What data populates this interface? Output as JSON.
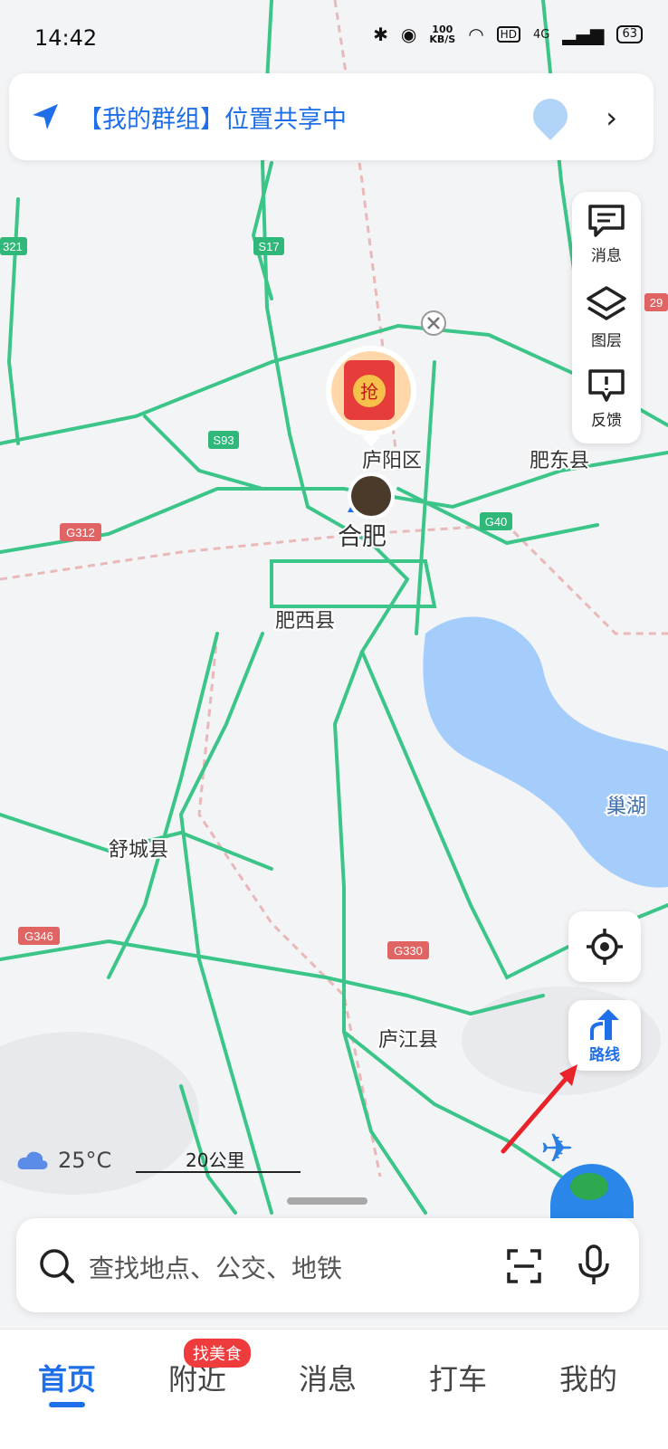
{
  "status_bar": {
    "time": "14:42",
    "speed_value": "100",
    "speed_unit": "KB/S",
    "network": "4G",
    "battery": "63"
  },
  "share_banner": {
    "text": "【我的群组】位置共享中"
  },
  "side_panel": {
    "messages": "消息",
    "layers": "图层",
    "feedback": "反馈"
  },
  "map_labels": {
    "districts": [
      "庐阳区",
      "肥东县",
      "合肥",
      "肥西县",
      "舒城县",
      "庐江县",
      "巢湖"
    ],
    "roads": [
      "S17",
      "S93",
      "G312",
      "G40",
      "G346",
      "G330",
      "321",
      "29"
    ]
  },
  "promo": {
    "text": "抢"
  },
  "weather": {
    "temp": "25°C"
  },
  "scale_bar": {
    "label": "20公里"
  },
  "route_button": {
    "label": "路线"
  },
  "search": {
    "placeholder": "查找地点、公交、地铁"
  },
  "tabs": [
    {
      "label": "首页",
      "active": true
    },
    {
      "label": "附近",
      "badge": "找美食"
    },
    {
      "label": "消息"
    },
    {
      "label": "打车"
    },
    {
      "label": "我的"
    }
  ],
  "colors": {
    "accent": "#1e6fe8",
    "road": "#3cc588",
    "water": "#a5cdfb",
    "badge": "#ef3b3b"
  }
}
